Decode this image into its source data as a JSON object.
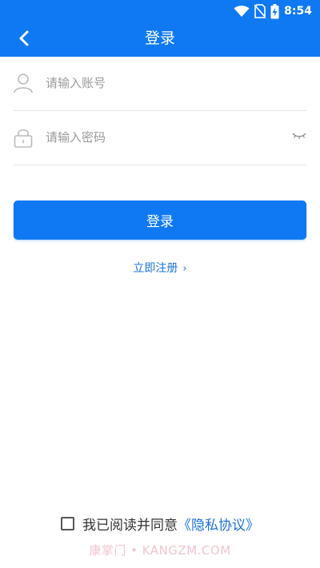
{
  "status_bar": {
    "time": "8:54",
    "icons": [
      "wifi-icon",
      "no-sim-icon",
      "battery-charging-icon"
    ]
  },
  "header": {
    "title": "登录",
    "back_icon": "chevron-left-icon",
    "background": "#0f79f3"
  },
  "form": {
    "account": {
      "placeholder": "请输入账号",
      "icon": "user-icon"
    },
    "password": {
      "placeholder": "请输入密码",
      "icon": "lock-icon",
      "toggle_icon": "eye-closed-icon"
    },
    "login_button": "登录",
    "register_link": "立即注册",
    "register_chevron": "›"
  },
  "agreement": {
    "prefix": "我已阅读并同意",
    "link": "《隐私协议》",
    "checked": false
  },
  "watermark": "康掌门 • KANGZM.COM",
  "colors": {
    "primary": "#0f79f3",
    "link": "#1a73d9",
    "placeholder": "#9a9a9a"
  }
}
